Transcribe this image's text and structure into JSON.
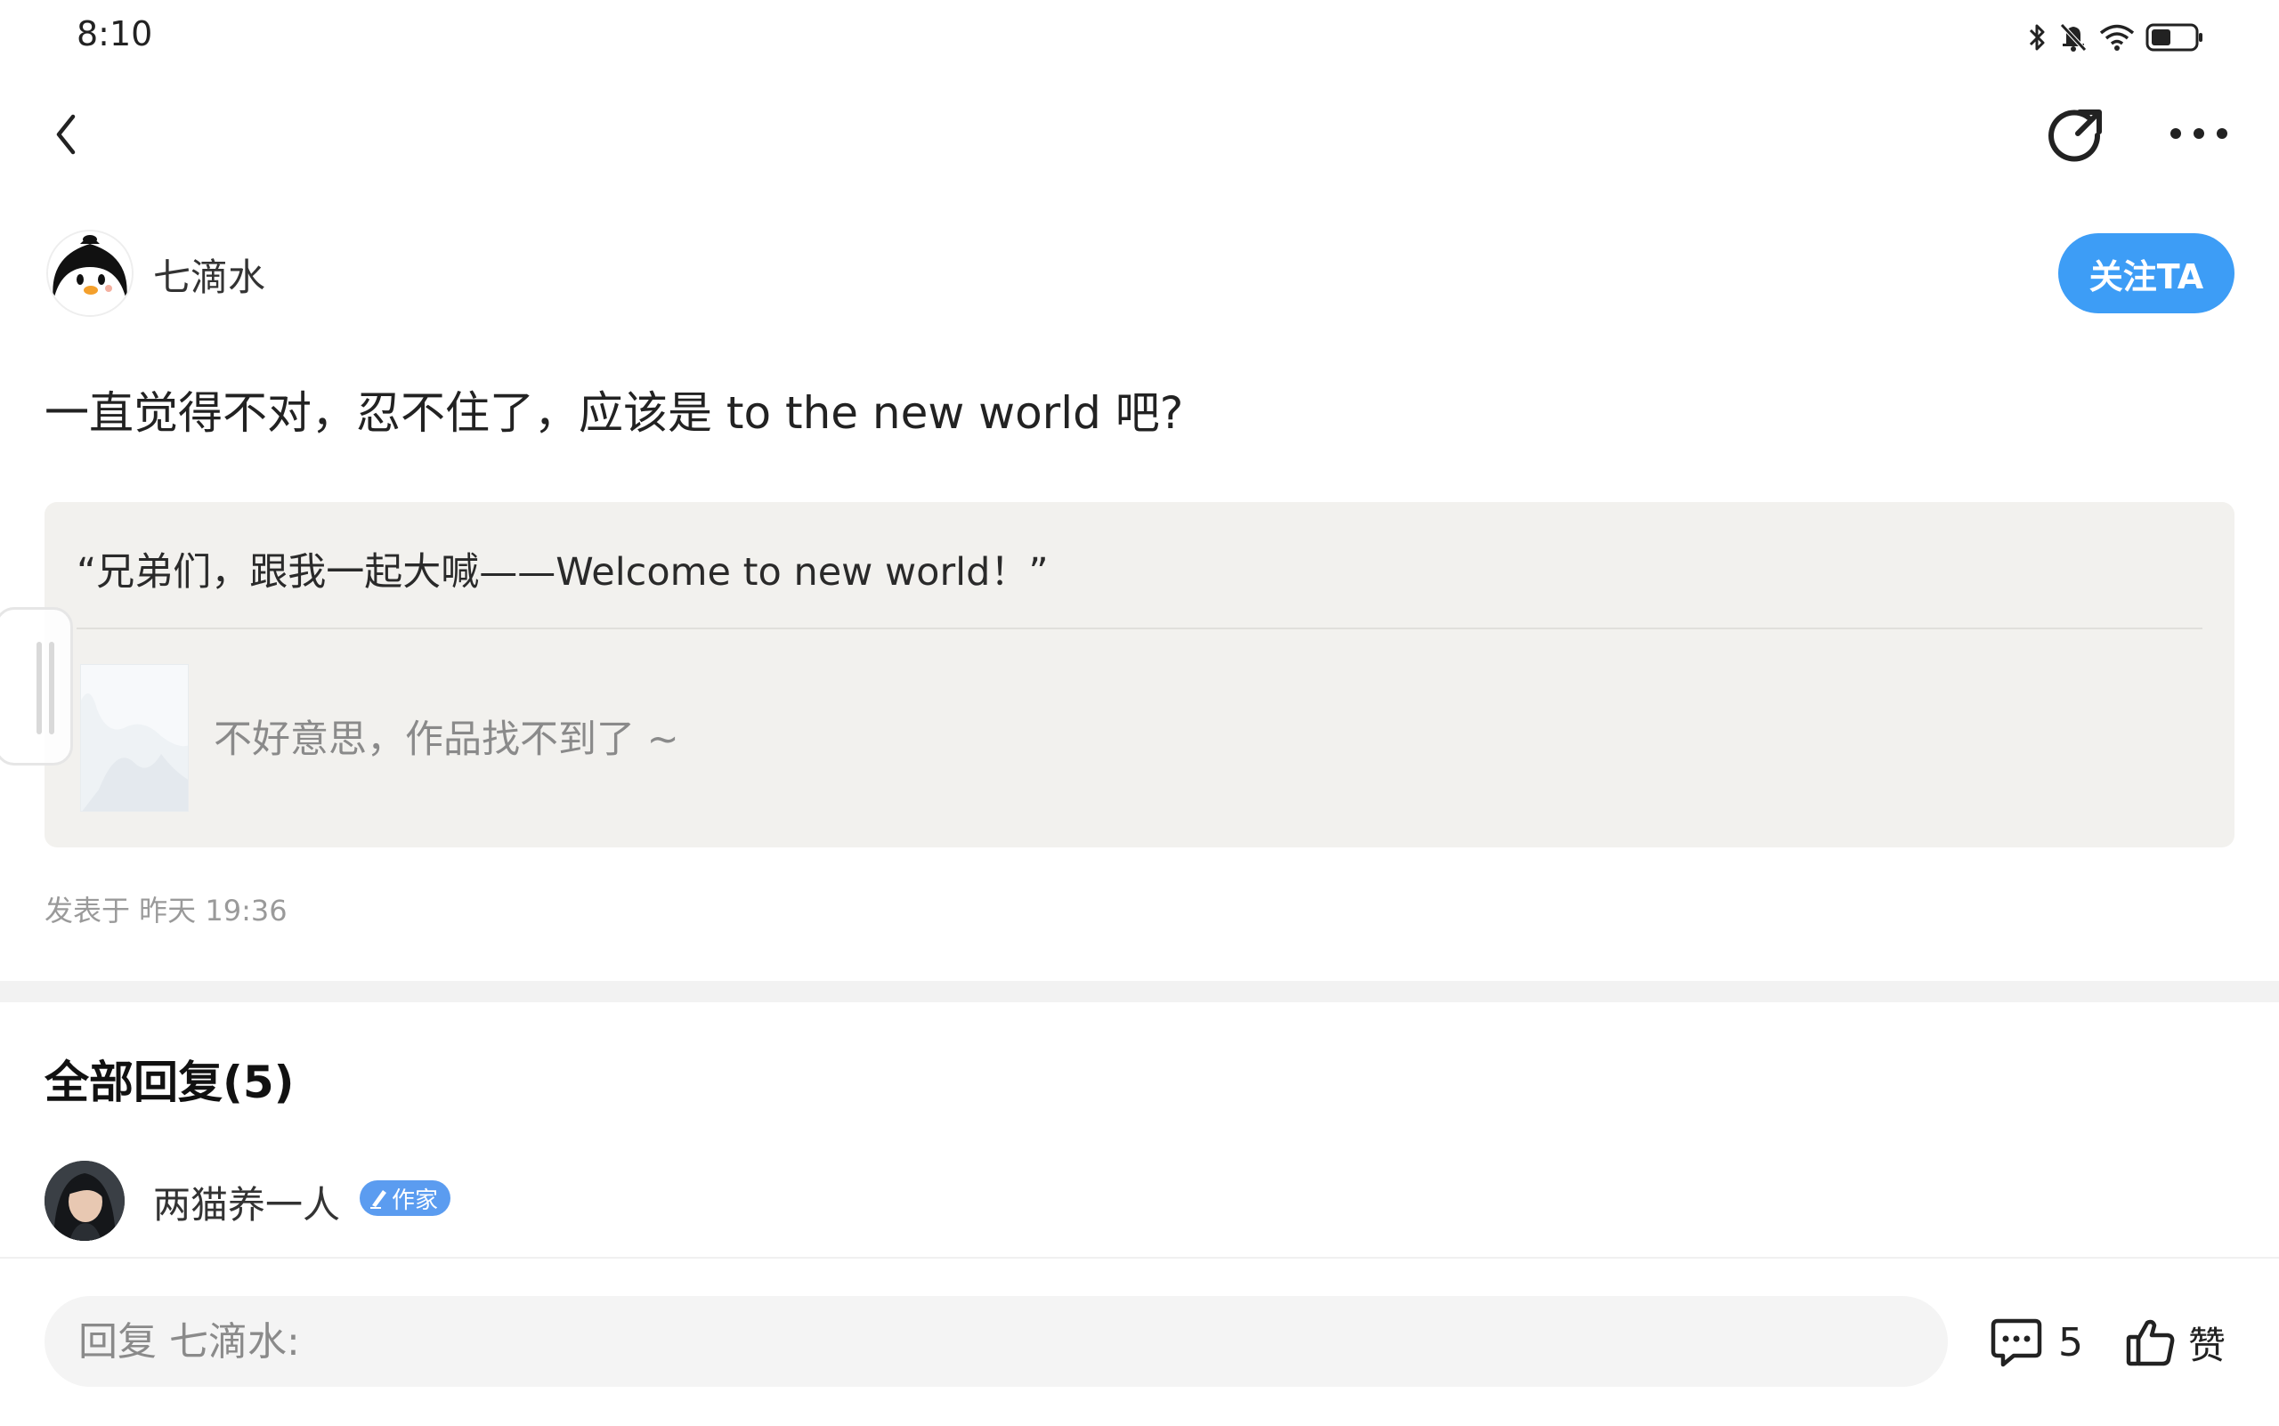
{
  "status_bar": {
    "time": "8:10",
    "icons": [
      "bluetooth-icon",
      "bell-muted-icon",
      "wifi-icon",
      "battery-icon"
    ],
    "battery_level": 0.45
  },
  "nav": {
    "back_icon": "chevron-left-icon",
    "share_icon": "share-arrow-icon",
    "more_icon": "more-dots-icon"
  },
  "post": {
    "author": "七滴水",
    "follow_label": "关注TA",
    "text": "一直觉得不对，忍不住了，应该是 to the new world 吧?",
    "quote": "“兄弟们，跟我一起大喊——Welcome to new world！”",
    "work_missing": "不好意思，作品找不到了 ~",
    "posted_at": "发表于 昨天 19:36"
  },
  "replies": {
    "heading": "全部回复(5)",
    "first": {
      "name": "两猫养一人",
      "badge": "作家"
    }
  },
  "bottom_bar": {
    "reply_placeholder": "回复 七滴水:",
    "comment_count": "5",
    "like_label": "赞"
  },
  "colors": {
    "accent": "#3d9df6",
    "badge": "#5b9cf0",
    "quote_bg": "#f2f1ee"
  }
}
